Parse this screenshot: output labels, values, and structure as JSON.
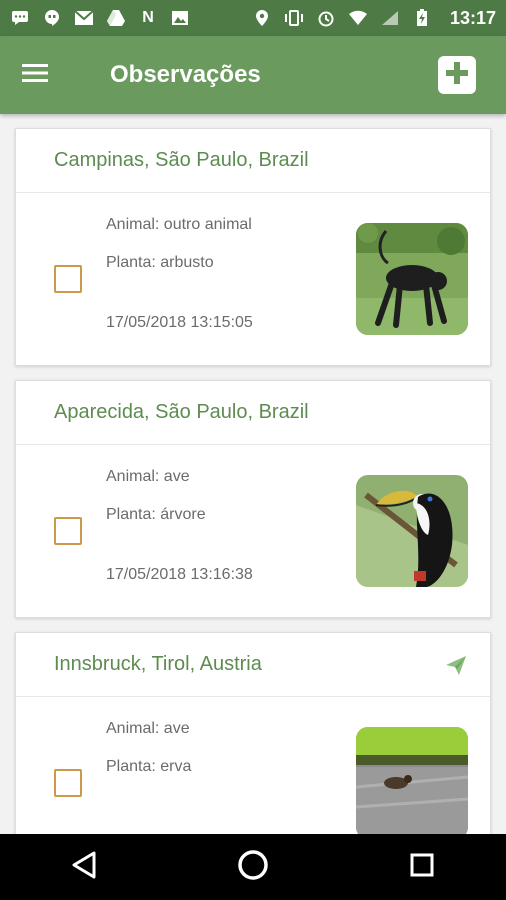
{
  "status_bar": {
    "time": "13:17",
    "icons": [
      "message-icon",
      "hangouts-icon",
      "gmail-icon",
      "drive-icon",
      "n-icon",
      "image-icon",
      "location-icon",
      "vibrate-icon",
      "alarm-icon",
      "wifi-icon",
      "signal-icon",
      "battery-icon"
    ]
  },
  "app_bar": {
    "title": "Observações",
    "menu_icon": "hamburger-menu-icon",
    "add_icon": "add-icon"
  },
  "observations": [
    {
      "location": "Campinas, São Paulo, Brazil",
      "animal": "Animal: outro animal",
      "plant": "Planta: arbusto",
      "timestamp": "17/05/2018 13:15:05",
      "checked": false,
      "sent": false,
      "image": "monkey-photo"
    },
    {
      "location": "Aparecida, São Paulo, Brazil",
      "animal": "Animal: ave",
      "plant": "Planta: árvore",
      "timestamp": "17/05/2018 13:16:38",
      "checked": false,
      "sent": false,
      "image": "toucan-photo"
    },
    {
      "location": "Innsbruck, Tirol, Austria",
      "animal": "Animal: ave",
      "plant": "Planta: erva",
      "timestamp": "",
      "checked": false,
      "sent": true,
      "image": "bird-pavement-photo"
    }
  ],
  "colors": {
    "status_bar": "#4e7a45",
    "app_bar": "#6b9a5f",
    "title_text": "#5d8c50",
    "checkbox_border": "#cc9a4a"
  },
  "nav_bar": {
    "back_icon": "back-triangle-icon",
    "home_icon": "home-circle-icon",
    "recents_icon": "recents-square-icon"
  }
}
